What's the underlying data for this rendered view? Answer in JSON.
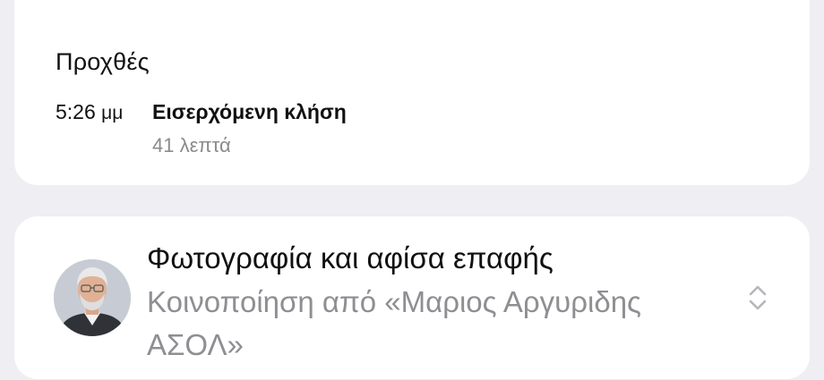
{
  "call_card": {
    "date_label": "Προχθές",
    "time": "5:26",
    "ampm": "μμ",
    "call_type": "Εισερχόμενη κλήση",
    "duration": "41 λεπτά"
  },
  "contact_card": {
    "title": "Φωτογραφία και αφίσα επαφής",
    "subtitle": "Κοινοποίηση από «Μαριος Αργυριδης ΑΣΟΛ»",
    "avatar_icon": "contact-photo",
    "control_icon": "chevron-up-down-icon"
  },
  "colors": {
    "background": "#eeeef3",
    "card": "#ffffff",
    "secondary_text": "#8e8e93"
  }
}
